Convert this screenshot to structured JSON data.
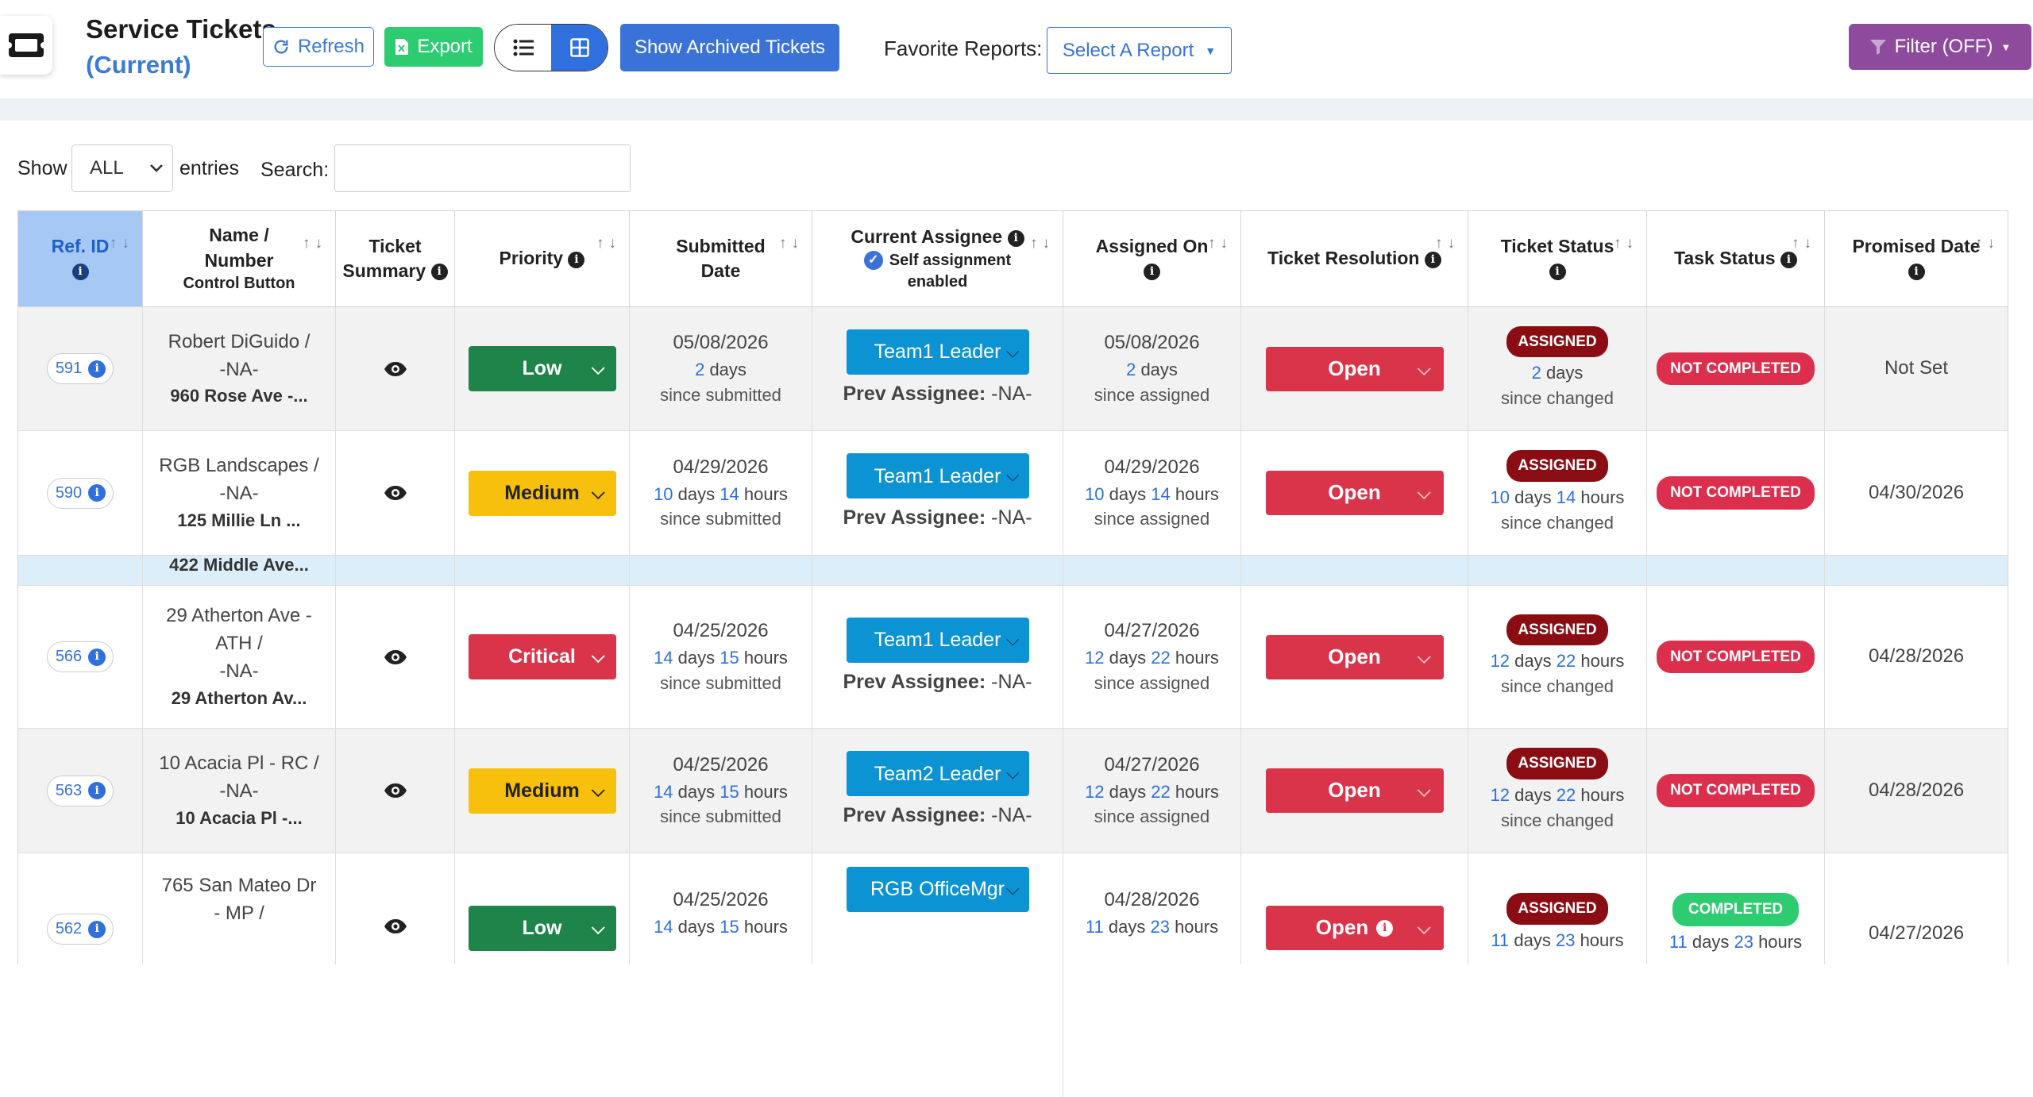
{
  "header": {
    "title_line1": "Service Tickets",
    "title_line2": "(Current)",
    "refresh_label": "Refresh",
    "export_label": "Export",
    "archived_label": "Show Archived Tickets",
    "favorite_label": "Favorite Reports:",
    "report_select": "Select A Report",
    "filter_label": "Filter (OFF)"
  },
  "controls": {
    "show_label": "Show",
    "entries_value": "ALL",
    "entries_label": "entries",
    "search_label": "Search:",
    "search_value": ""
  },
  "columns": {
    "ref_id": "Ref. ID",
    "name_l1": "Name /",
    "name_l2": "Number",
    "name_l3": "Control Button",
    "summary_l1": "Ticket",
    "summary_l2": "Summary",
    "priority": "Priority",
    "submitted_l1": "Submitted",
    "submitted_l2": "Date",
    "assignee_l1": "Current Assignee",
    "assignee_l2": "Self assignment",
    "assignee_l3": "enabled",
    "assigned_on_l1": "Assigned On",
    "resolution": "Ticket Resolution",
    "status_l1": "Ticket Status",
    "task_status": "Task Status",
    "promised": "Promised Date",
    "sort_arrows": "↑↓"
  },
  "labels": {
    "days": "days",
    "hours": "hours",
    "since_submitted": "since submitted",
    "since_assigned": "since assigned",
    "since_changed": "since changed",
    "prev_assignee": "Prev Assignee:",
    "na": "-NA-"
  },
  "rows": [
    {
      "ref": "591",
      "name1": "Robert DiGuido /",
      "name2": "-NA-",
      "name3": "",
      "addr": "960 Rose Ave -...",
      "priority": "Low",
      "sub_date": "05/08/2026",
      "sub_days": "2",
      "sub_hours": "",
      "assignee": "Team1 Leader",
      "asg_date": "05/08/2026",
      "asg_days": "2",
      "asg_hours": "",
      "resolution": "Open",
      "status": "ASSIGNED",
      "st_days": "2",
      "st_hours": "",
      "task": "NOT COMPLETED",
      "promised": "Not Set"
    },
    {
      "ref": "590",
      "name1": "RGB Landscapes /",
      "name2": "-NA-",
      "name3": "",
      "addr": "125 Millie Ln ...",
      "priority": "Medium",
      "sub_date": "04/29/2026",
      "sub_days": "10",
      "sub_hours": "14",
      "assignee": "Team1 Leader",
      "asg_date": "04/29/2026",
      "asg_days": "10",
      "asg_hours": "14",
      "resolution": "Open",
      "status": "ASSIGNED",
      "st_days": "10",
      "st_hours": "14",
      "task": "NOT COMPLETED",
      "promised": "04/30/2026"
    },
    {
      "ref": "566",
      "name1": "29 Atherton Ave -",
      "name2": "ATH /",
      "name3": "-NA-",
      "addr": "29 Atherton Av...",
      "priority": "Critical",
      "sub_date": "04/25/2026",
      "sub_days": "14",
      "sub_hours": "15",
      "assignee": "Team1 Leader",
      "asg_date": "04/27/2026",
      "asg_days": "12",
      "asg_hours": "22",
      "resolution": "Open",
      "status": "ASSIGNED",
      "st_days": "12",
      "st_hours": "22",
      "task": "NOT COMPLETED",
      "promised": "04/28/2026"
    },
    {
      "ref": "563",
      "name1": "10 Acacia Pl - RC /",
      "name2": "-NA-",
      "name3": "",
      "addr": "10 Acacia Pl -...",
      "priority": "Medium",
      "sub_date": "04/25/2026",
      "sub_days": "14",
      "sub_hours": "15",
      "assignee": "Team2 Leader",
      "asg_date": "04/27/2026",
      "asg_days": "12",
      "asg_hours": "22",
      "resolution": "Open",
      "status": "ASSIGNED",
      "st_days": "12",
      "st_hours": "22",
      "task": "NOT COMPLETED",
      "promised": "04/28/2026"
    },
    {
      "ref": "562",
      "name1": "765 San Mateo Dr",
      "name2": "- MP /",
      "name3": "",
      "addr": "",
      "priority": "Low",
      "sub_date": "04/25/2026",
      "sub_days": "14",
      "sub_hours": "15",
      "assignee": "RGB OfficeMgr",
      "asg_date": "04/28/2026",
      "asg_days": "11",
      "asg_hours": "23",
      "resolution": "Open",
      "status": "ASSIGNED",
      "st_days": "11",
      "st_hours": "23",
      "task": "COMPLETED",
      "promised": "04/27/2026"
    }
  ],
  "partial_row": {
    "addr": "422 Middle Ave..."
  }
}
